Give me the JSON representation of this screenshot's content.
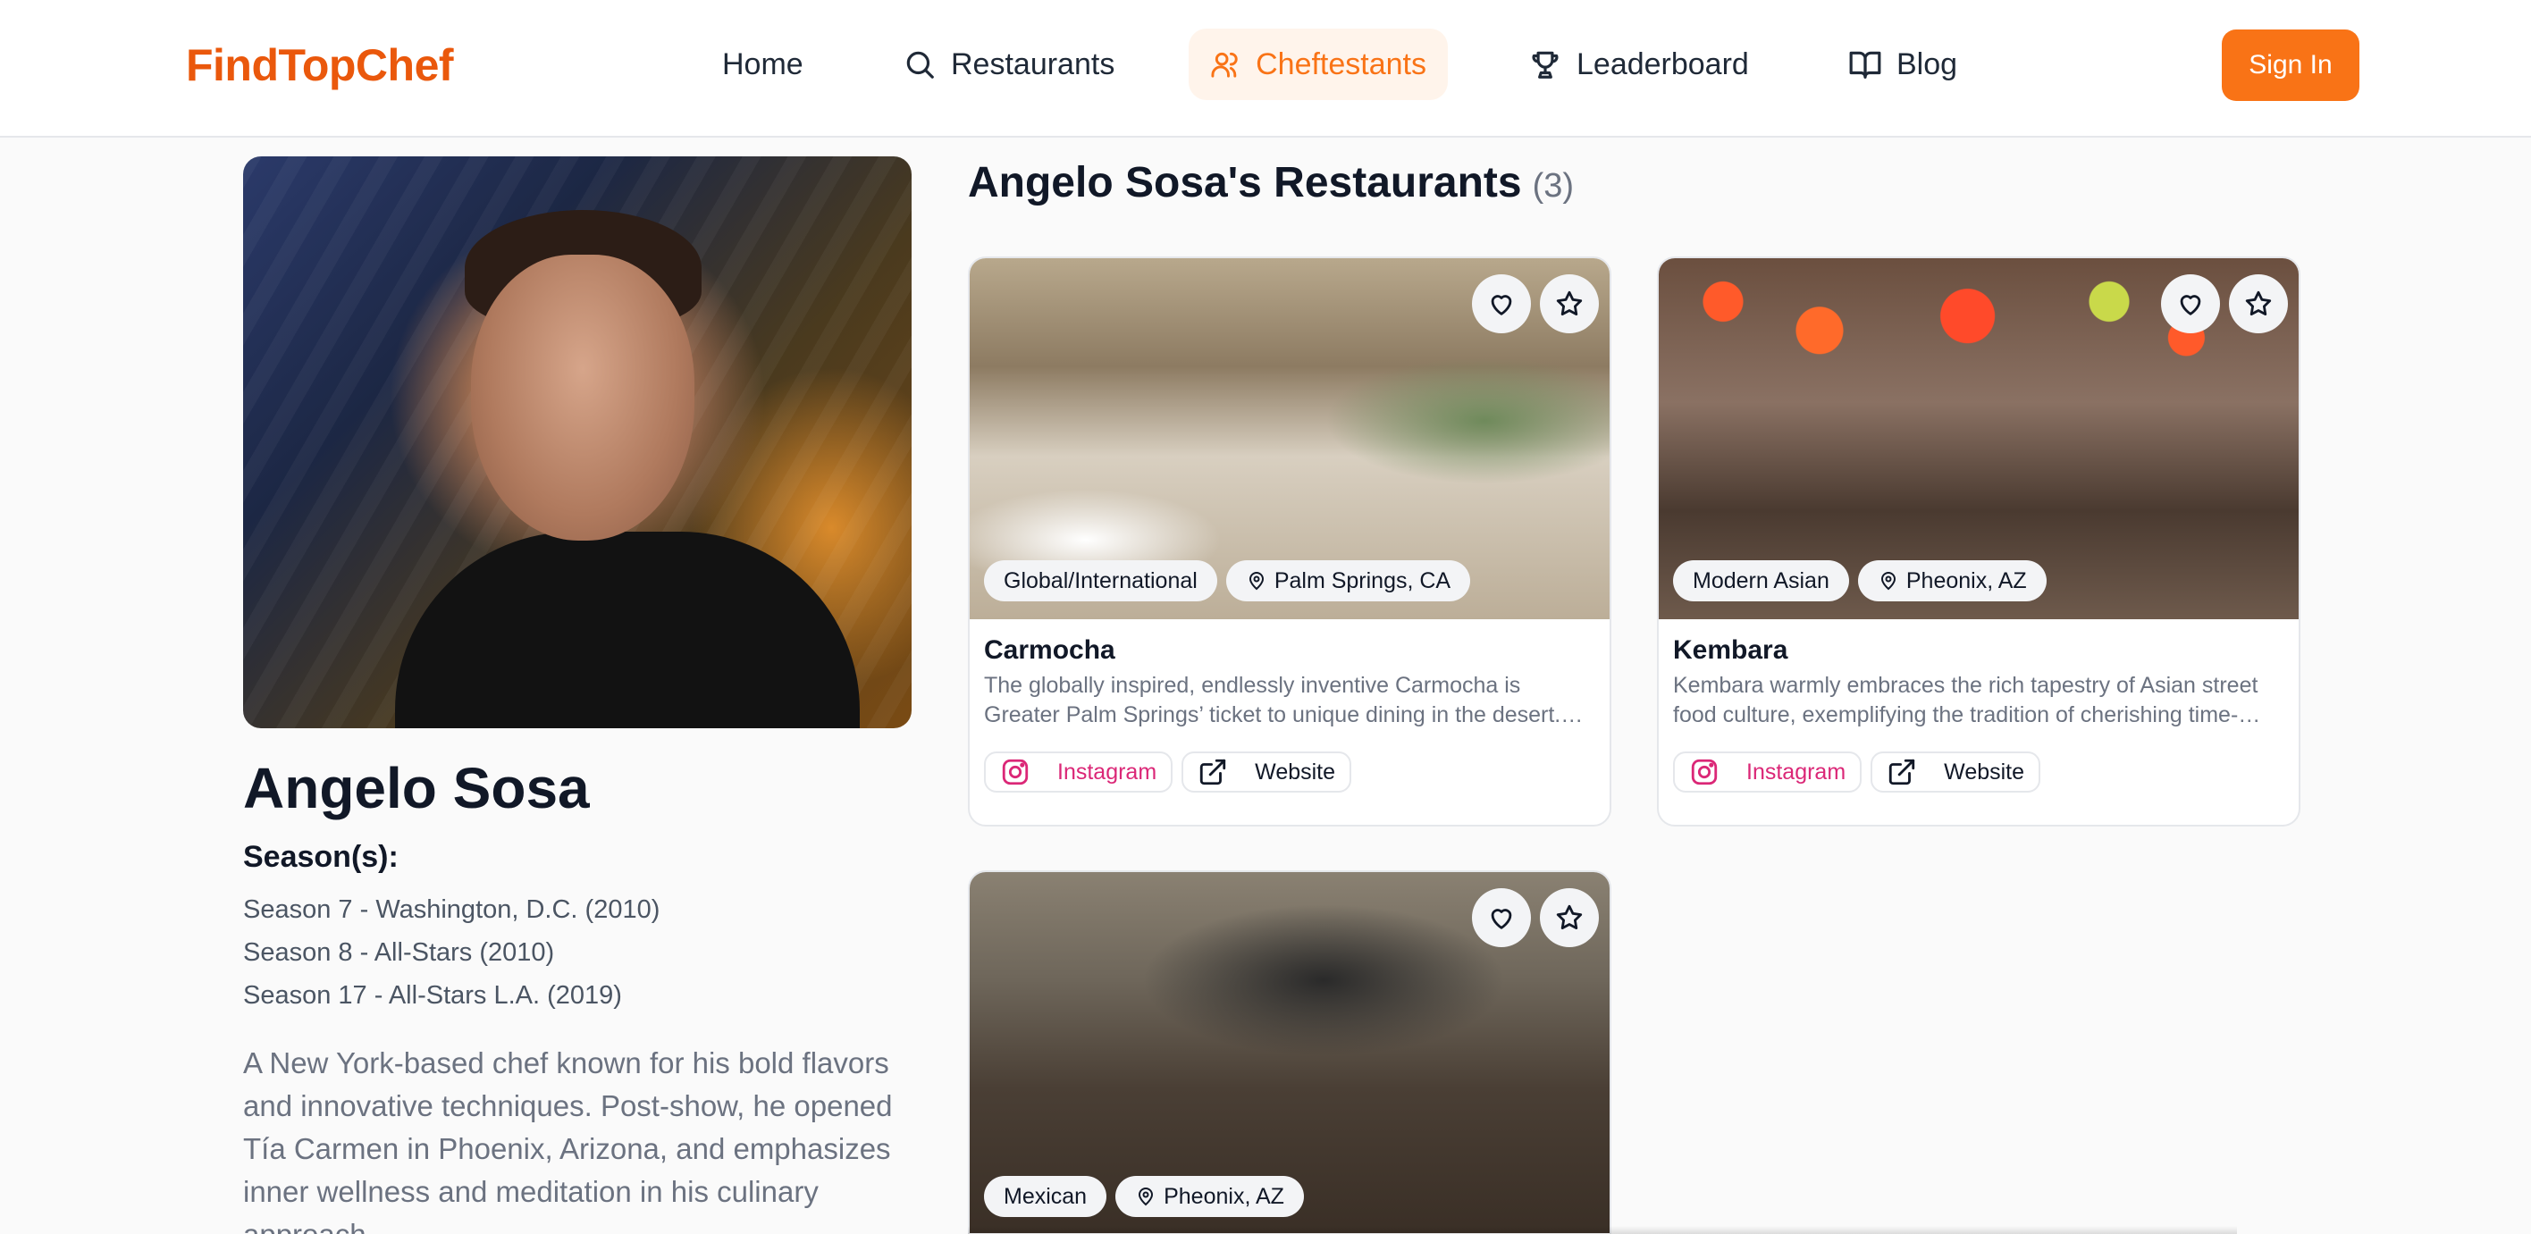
{
  "brand": {
    "name": "FindTopChef",
    "color": "#ea580c"
  },
  "nav": {
    "items": [
      {
        "label": "Home",
        "icon": null,
        "active": false
      },
      {
        "label": "Restaurants",
        "icon": "search-icon",
        "active": false
      },
      {
        "label": "Cheftestants",
        "icon": "users-icon",
        "active": true
      },
      {
        "label": "Leaderboard",
        "icon": "trophy-icon",
        "active": false
      },
      {
        "label": "Blog",
        "icon": "book-icon",
        "active": false
      }
    ],
    "signin_label": "Sign In",
    "accent": "#f97316"
  },
  "chef": {
    "name": "Angelo Sosa",
    "seasons_label": "Season(s):",
    "seasons": [
      "Season 7 - Washington, D.C. (2010)",
      "Season 8 - All-Stars (2010)",
      "Season 17 - All-Stars L.A. (2019)"
    ],
    "bio": "A New York-based chef known for his bold flavors and innovative techniques. Post-show, he opened Tía Carmen in Phoenix, Arizona, and emphasizes inner wellness and meditation in his culinary approach."
  },
  "restaurants_section": {
    "title": "Angelo Sosa's Restaurants",
    "count": "(3)",
    "items": [
      {
        "name": "Carmocha",
        "cuisine": "Global/International",
        "location": "Palm Springs, CA",
        "description": "The globally inspired, endlessly inventive Carmocha is Greater Palm Springs’ ticket to unique dining in the desert.…",
        "instagram_label": "Instagram",
        "website_label": "Website"
      },
      {
        "name": "Kembara",
        "cuisine": "Modern Asian",
        "location": "Pheonix, AZ",
        "description": "Kembara warmly embraces the rich tapestry of Asian street food culture, exemplifying the tradition of cherishing time-…",
        "instagram_label": "Instagram",
        "website_label": "Website"
      },
      {
        "name": "",
        "cuisine": "Mexican",
        "location": "Pheonix, AZ",
        "description": "",
        "instagram_label": "",
        "website_label": ""
      }
    ]
  }
}
